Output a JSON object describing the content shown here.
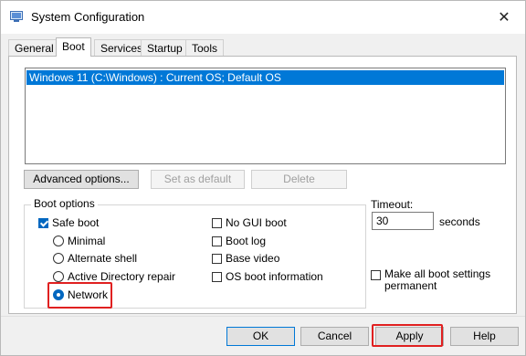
{
  "window": {
    "title": "System Configuration",
    "close_glyph": "✕"
  },
  "tabs": [
    {
      "label": "General"
    },
    {
      "label": "Boot"
    },
    {
      "label": "Services"
    },
    {
      "label": "Startup"
    },
    {
      "label": "Tools"
    }
  ],
  "os_list": {
    "items": [
      "Windows 11 (C:\\Windows) : Current OS; Default OS"
    ]
  },
  "buttons": {
    "advanced": "Advanced options...",
    "set_default": "Set as default",
    "delete": "Delete",
    "ok": "OK",
    "cancel": "Cancel",
    "apply": "Apply",
    "help": "Help"
  },
  "boot_options": {
    "label": "Boot options",
    "safe_boot": {
      "label": "Safe boot",
      "checked": true
    },
    "radios": {
      "minimal": {
        "label": "Minimal",
        "checked": false
      },
      "alternate_shell": {
        "label": "Alternate shell",
        "checked": false
      },
      "ad_repair": {
        "label": "Active Directory repair",
        "checked": false
      },
      "network": {
        "label": "Network",
        "checked": true
      }
    },
    "no_gui_boot": {
      "label": "No GUI boot",
      "checked": false
    },
    "boot_log": {
      "label": "Boot log",
      "checked": false
    },
    "base_video": {
      "label": "Base video",
      "checked": false
    },
    "os_boot_info": {
      "label": "OS boot information",
      "checked": false
    }
  },
  "timeout": {
    "label": "Timeout:",
    "value": "30",
    "unit": "seconds"
  },
  "make_permanent": {
    "label_line1": "Make all boot settings",
    "label_line2": "permanent",
    "checked": false
  },
  "colors": {
    "selection": "#0078d7",
    "highlight": "#e02020",
    "accent": "#0067c0"
  }
}
